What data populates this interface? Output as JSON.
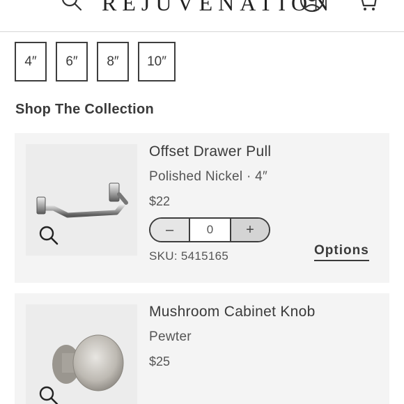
{
  "header": {
    "logo_text": "REJUVENATION",
    "menu_icon": "hamburger-menu-icon",
    "search_icon": "search-icon",
    "account_icon": "account-icon",
    "cart_icon": "cart-icon"
  },
  "sizes": [
    "4″",
    "6″",
    "8″",
    "10″"
  ],
  "section_title": "Shop The Collection",
  "products": [
    {
      "name": "Offset Drawer Pull",
      "variant": "Polished Nickel · 4″",
      "price": "$22",
      "quantity": "0",
      "minus_label": "–",
      "plus_label": "+",
      "sku": "SKU: 5415165",
      "options_label": "Options"
    },
    {
      "name": "Mushroom Cabinet Knob",
      "variant": "Pewter",
      "price": "$25"
    }
  ]
}
